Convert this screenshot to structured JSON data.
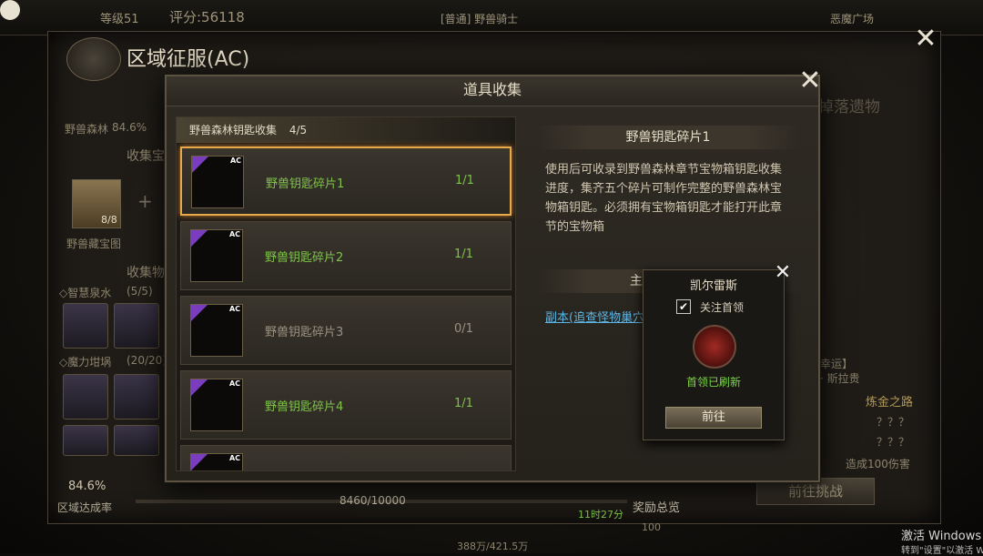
{
  "background": {
    "level": "等级51",
    "score": "评分:56118",
    "mode_tag": "[普通] 野兽骑士",
    "arena": "恶魔广场",
    "panel_title": "区域征服(AC)",
    "zone_label": "野兽森林",
    "zone_percent": "84.6%",
    "collect_treasure": "收集宝",
    "treasure_count": "8/8",
    "treasure_name": "野兽藏宝图",
    "collect_items": "收集物",
    "wisdom_water": "◇智慧泉水",
    "wisdom_count": "(5/5)",
    "magic_pot": "◇魔力坩埚",
    "magic_count": "(20/20)",
    "relic": "掉落遗物",
    "lucky": "幸运】",
    "npc": "· 斯拉贵",
    "gold_road": "炼金之路",
    "unknown1": "？？？",
    "unknown2": "？？？",
    "damage": "造成100伤害",
    "completion": "84.6%",
    "completion_label": "区域达成率",
    "progress": "8460/10000",
    "timer": "11时27分",
    "reward_overview": "奖励总览",
    "reward_value": "100",
    "challenge_btn": "前往挑战",
    "gold_bottom": "388万/421.5万",
    "watermark_line1": "激活 Windows",
    "watermark_line2": "转到\"设置\"以激活 W"
  },
  "dialog": {
    "title": "道具收集",
    "list_header": "野兽森林钥匙收集",
    "list_progress": "4/5",
    "items": [
      {
        "name": "野兽钥匙碎片1",
        "count": "1/1",
        "badge": "AC",
        "owned": true,
        "selected": true
      },
      {
        "name": "野兽钥匙碎片2",
        "count": "1/1",
        "badge": "AC",
        "owned": true,
        "selected": false
      },
      {
        "name": "野兽钥匙碎片3",
        "count": "0/1",
        "badge": "AC",
        "owned": false,
        "selected": false
      },
      {
        "name": "野兽钥匙碎片4",
        "count": "1/1",
        "badge": "AC",
        "owned": true,
        "selected": false
      },
      {
        "name": "",
        "count": "",
        "badge": "AC",
        "owned": false,
        "selected": false
      }
    ],
    "detail_title": "野兽钥匙碎片1",
    "detail_desc": "使用后可收录到野兽森林章节宝物箱钥匙收集进度，集齐五个碎片可制作完整的野兽森林宝物箱钥匙。必须拥有宝物箱钥匙才能打开此章节的宝物箱",
    "source_header": "主要获取途径",
    "source_link": "副本(追查怪物巢穴)"
  },
  "popup": {
    "title": "凯尔雷斯",
    "follow_label": "关注首领",
    "follow_checked": true,
    "status": "首领已刷新",
    "go_button": "前往"
  },
  "colors": {
    "owned_green": "#7fc34a",
    "selected_border": "#e7a94a",
    "link_blue": "#5fb3e0"
  }
}
